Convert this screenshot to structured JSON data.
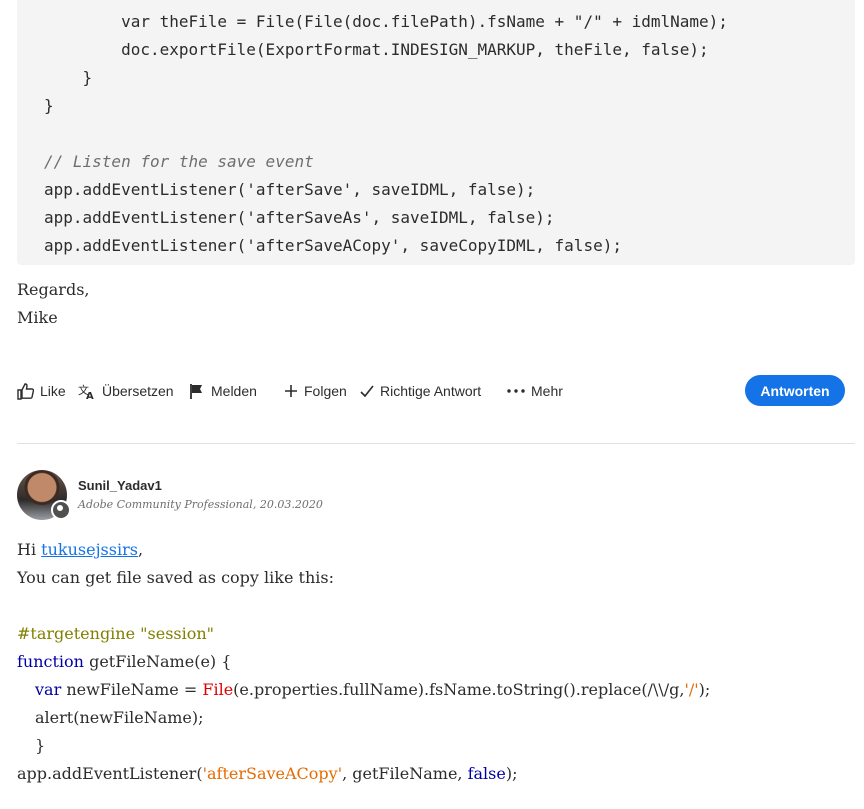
{
  "code_block": {
    "lines": [
      "        var theFile = File(File(doc.filePath).fsName + \"/\" + idmlName);",
      "        doc.exportFile(ExportFormat.INDESIGN_MARKUP, theFile, false);",
      "    }",
      "}",
      "",
      "// Listen for the save event",
      "app.addEventListener('afterSave', saveIDML, false);",
      "app.addEventListener('afterSaveAs', saveIDML, false);",
      "app.addEventListener('afterSaveACopy', saveCopyIDML, false);"
    ]
  },
  "signature": {
    "line1": "Regards,",
    "line2": "Mike"
  },
  "actions": {
    "like": "Like",
    "translate": "Übersetzen",
    "report": "Melden",
    "follow": "Folgen",
    "correct": "Richtige Antwort",
    "more": "Mehr",
    "reply": "Antworten"
  },
  "reply_post": {
    "author": "Sunil_Yadav1",
    "role": "Adobe Community Professional",
    "date": ", 20.03.2020",
    "greeting_prefix": "Hi ",
    "mention": "tukusejssirs",
    "greeting_suffix": ",",
    "intro": "You can get file saved as copy like this:",
    "code": {
      "engine": "#targetengine \"session\"",
      "fn_keyword": "function",
      "fn_sig": " getFileName(e) {",
      "l3_var": "var",
      "l3_a": " newFileName = ",
      "l3_file": "File",
      "l3_b": "(e.properties.fullName).fsName.toString().replace(/\\\\/g,",
      "l3_str": "'/'",
      "l3_c": ");",
      "l4": "alert(newFileName);",
      "l5": "}",
      "l6_a": "app.addEventListener(",
      "l6_str": "'afterSaveACopy'",
      "l6_b": ", getFileName, ",
      "l6_false": "false",
      "l6_c": ");"
    }
  }
}
